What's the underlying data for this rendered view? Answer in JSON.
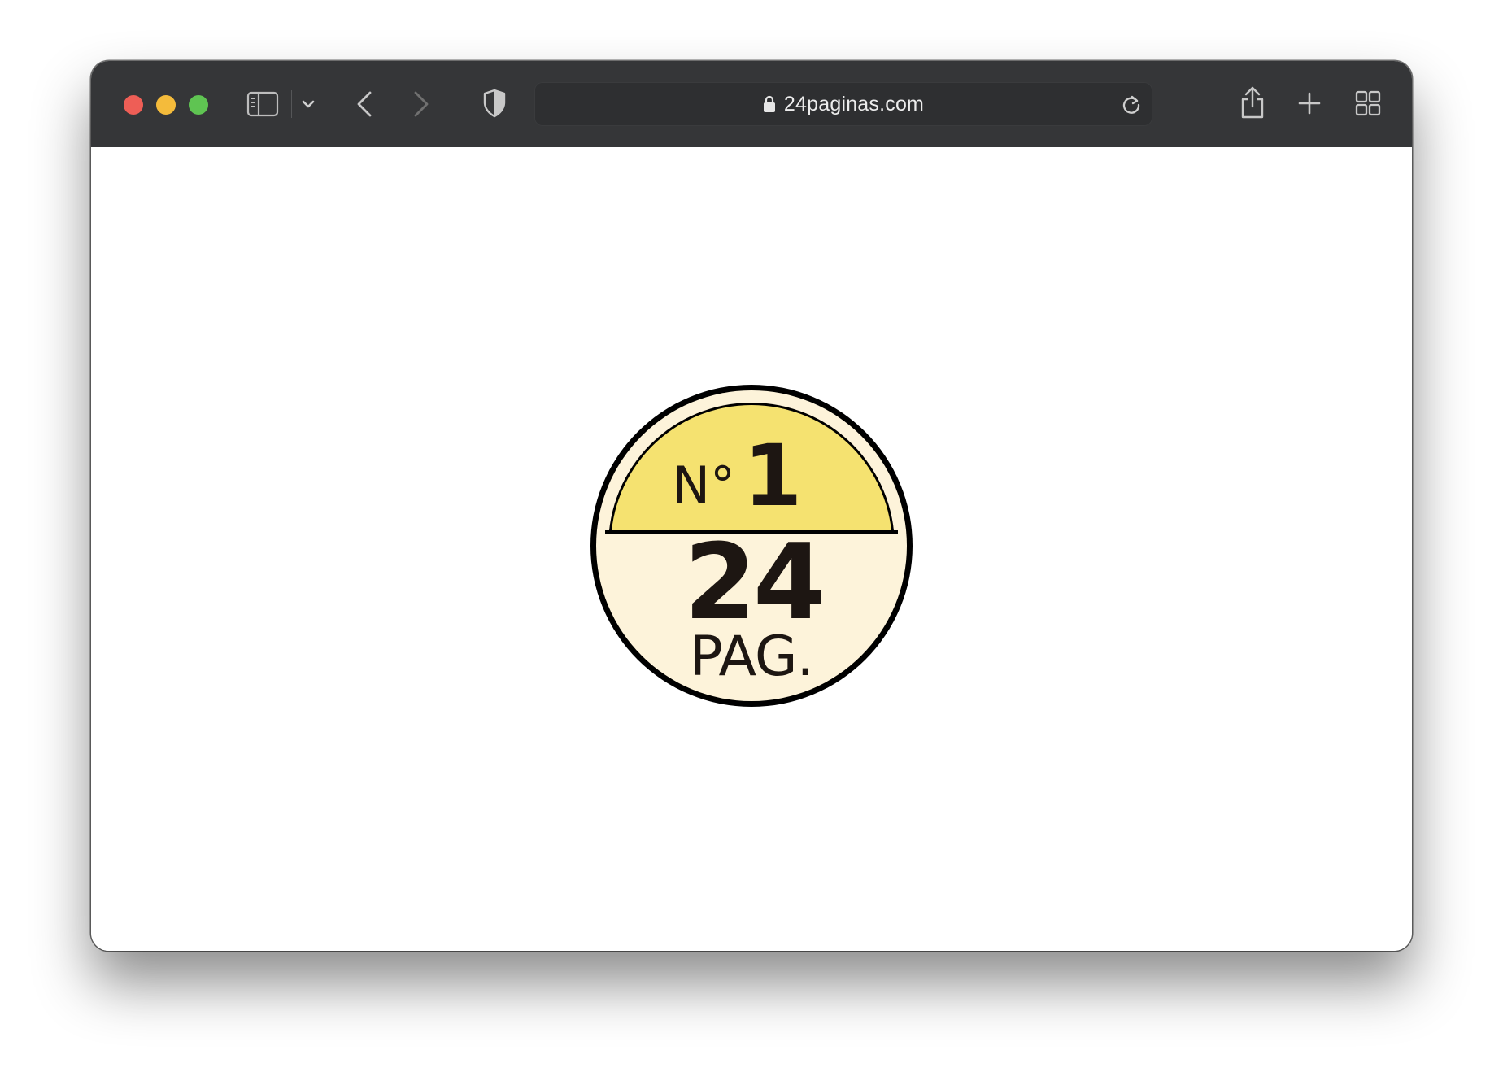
{
  "browser": {
    "url": "24paginas.com",
    "colors": {
      "toolbar": "#353638",
      "close": "#ee5e56",
      "minimize": "#f4bb3b",
      "maximize": "#5fc452"
    },
    "icons": [
      "sidebar-icon",
      "chevron-down-icon",
      "back-icon",
      "forward-icon",
      "shield-icon",
      "lock-icon",
      "reload-icon",
      "share-icon",
      "plus-icon",
      "tabs-grid-icon"
    ]
  },
  "logo": {
    "number_prefix": "N°",
    "number": "1",
    "pages": "24",
    "pages_label": "PAG.",
    "colors": {
      "top": "#f5e270",
      "bottom": "#fdf3da",
      "outline": "#000000",
      "text": "#1d1612"
    }
  }
}
